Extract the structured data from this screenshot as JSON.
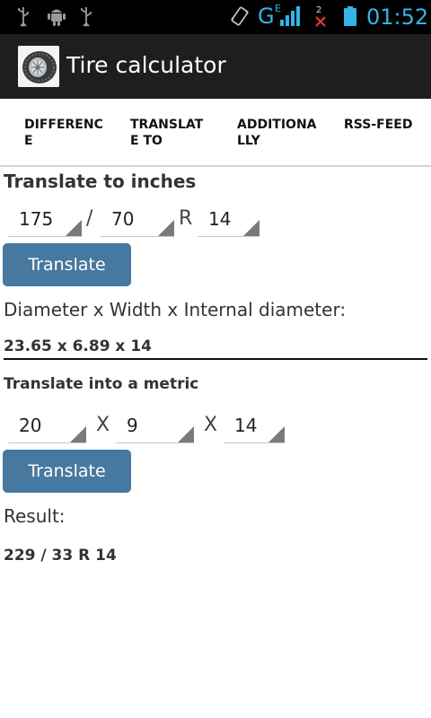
{
  "status_bar": {
    "icons": [
      "usb-icon",
      "android-debug-icon",
      "usb-icon",
      "vibrate-icon",
      "signal-icon",
      "no-sim-icon",
      "battery-icon"
    ],
    "network_type": "G",
    "network_sub": "E",
    "sim_slot": "2",
    "time": "01:52",
    "accent_color": "#33b5e5"
  },
  "action_bar": {
    "title": "Tire calculator",
    "icon": "tire-icon"
  },
  "tabs": [
    {
      "label": "DIFFERENCE"
    },
    {
      "label": "TRANSLATE TO"
    },
    {
      "label": "ADDITIONALLY"
    },
    {
      "label": "RSS-FEED"
    }
  ],
  "inches_section": {
    "title": "Translate to inches",
    "width_value": "175",
    "separator_slash": "/",
    "profile_value": "70",
    "separator_r": "R",
    "rim_value": "14",
    "button_label": "Translate",
    "result_label": "Diameter x Width x Internal diameter:",
    "result_value": "23.65 x 6.89 x 14"
  },
  "metric_section": {
    "title": "Translate into a metric",
    "diameter_value": "20",
    "separator_x1": "X",
    "width_value": "9",
    "separator_x2": "X",
    "rim_value": "14",
    "button_label": "Translate",
    "result_label": "Result:",
    "result_value": "229 / 33 R 14"
  },
  "colors": {
    "button": "#4778a0",
    "action_bar": "#1e1e1e"
  }
}
